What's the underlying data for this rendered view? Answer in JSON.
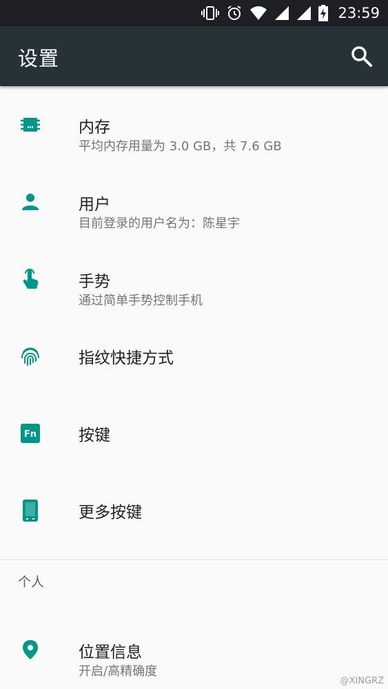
{
  "status_bar": {
    "time": "23:59",
    "icons": [
      "vibrate-icon",
      "alarm-icon",
      "wifi-icon",
      "signal-icon",
      "signal-icon",
      "battery-charging-icon"
    ]
  },
  "app_bar": {
    "title": "设置"
  },
  "items": [
    {
      "icon": "memory-chip-icon",
      "title": "内存",
      "subtitle": "平均内存用量为 3.0 GB，共 7.6 GB"
    },
    {
      "icon": "person-icon",
      "title": "用户",
      "subtitle": "目前登录的用户名为：陈星宇"
    },
    {
      "icon": "gesture-hand-icon",
      "title": "手势",
      "subtitle": "通过简单手势控制手机"
    },
    {
      "icon": "fingerprint-icon",
      "title": "指纹快捷方式"
    },
    {
      "icon": "fn-key-icon",
      "title": "按键",
      "icon_text": "Fn"
    },
    {
      "icon": "phone-buttons-icon",
      "title": "更多按键"
    }
  ],
  "section": {
    "title": "个人"
  },
  "location": {
    "icon": "location-pin-icon",
    "title": "位置信息",
    "subtitle": "开启/高精确度"
  },
  "watermark": "@XINGRZ",
  "colors": {
    "accent": "#009688",
    "app_bar": "#263238",
    "status_bar": "#1c2024"
  }
}
